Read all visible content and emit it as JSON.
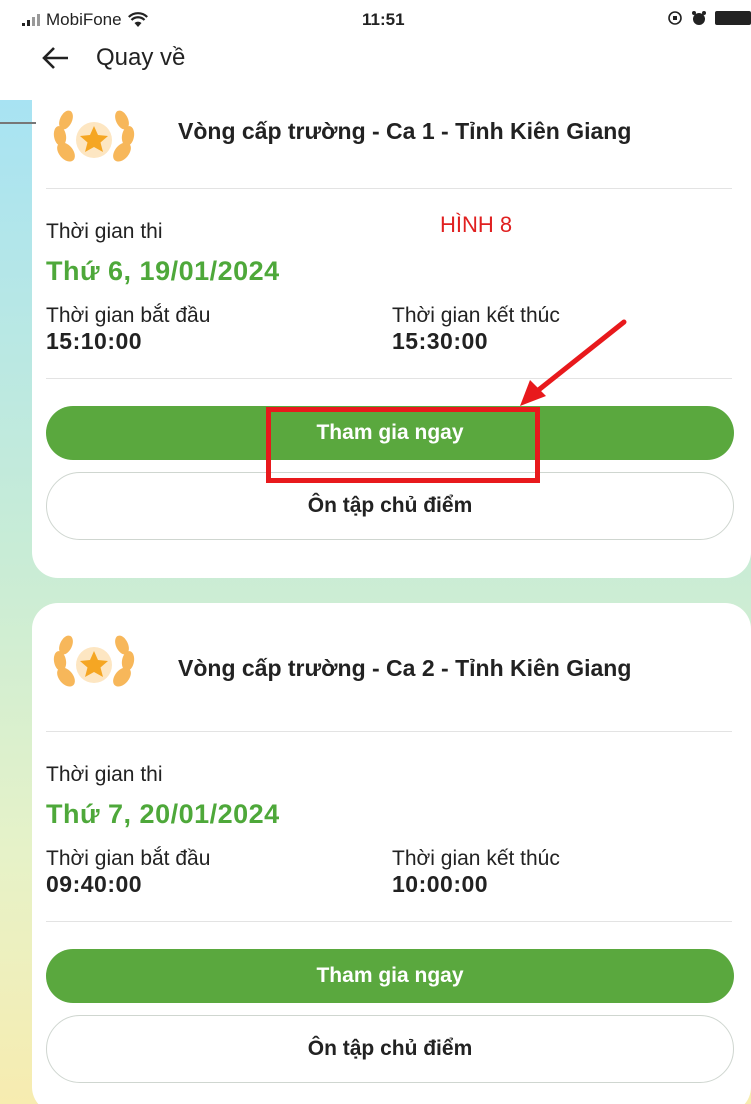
{
  "status_bar": {
    "carrier": "MobiFone",
    "time": "11:51"
  },
  "nav": {
    "back_label": "Quay về"
  },
  "annotation": {
    "label": "HÌNH 8",
    "color": "#e8191c"
  },
  "colors": {
    "primary_green": "#5aa83e",
    "date_green": "#4ea83a"
  },
  "exams": [
    {
      "title": "Vòng cấp trường - Ca 1 - Tỉnh Kiên Giang",
      "time_label": "Thời gian thi",
      "date": "Thứ 6, 19/01/2024",
      "start_label": "Thời gian bắt đầu",
      "start_time": "15:10:00",
      "end_label": "Thời gian kết thúc",
      "end_time": "15:30:00",
      "join_label": "Tham gia ngay",
      "review_label": "Ôn tập chủ điểm"
    },
    {
      "title": "Vòng cấp trường - Ca 2 - Tỉnh Kiên Giang",
      "time_label": "Thời gian thi",
      "date": "Thứ 7, 20/01/2024",
      "start_label": "Thời gian bắt đầu",
      "start_time": "09:40:00",
      "end_label": "Thời gian kết thúc",
      "end_time": "10:00:00",
      "join_label": "Tham gia ngay",
      "review_label": "Ôn tập chủ điểm"
    }
  ]
}
